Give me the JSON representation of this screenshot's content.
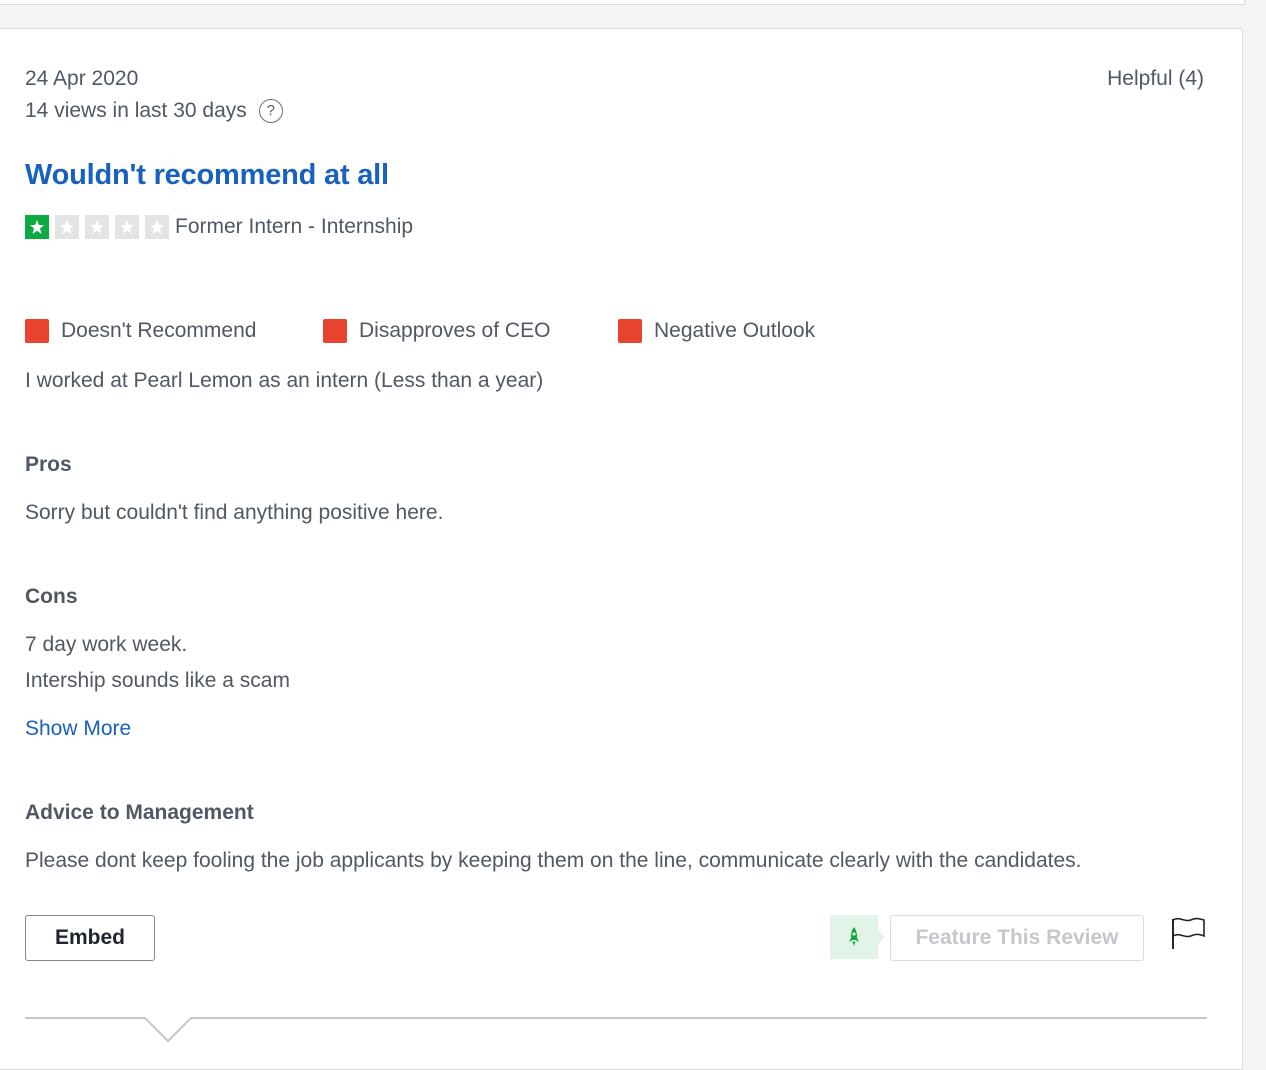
{
  "review": {
    "date": "24 Apr 2020",
    "views": "14 views in last 30 days",
    "help_glyph": "?",
    "helpful": "Helpful (4)",
    "title": "Wouldn't recommend at all",
    "rating": 1,
    "rating_max": 5,
    "job_title": "Former Intern - Internship",
    "indicators": [
      {
        "label": "Doesn't Recommend",
        "color": "#e8432f"
      },
      {
        "label": "Disapproves of CEO",
        "color": "#e8432f"
      },
      {
        "label": "Negative Outlook",
        "color": "#e8432f"
      }
    ],
    "employment": "I worked at Pearl Lemon as an intern (Less than a year)",
    "pros_heading": "Pros",
    "pros": "Sorry but couldn't find anything positive here.",
    "cons_heading": "Cons",
    "cons_lines": [
      "7 day work week.",
      "Intership sounds like a scam"
    ],
    "show_more": "Show More",
    "advice_heading": "Advice to Management",
    "advice": "Please dont keep fooling the job applicants by keeping them on the line, communicate clearly with the candidates."
  },
  "actions": {
    "embed_label": "Embed",
    "feature_label": "Feature This Review",
    "feature_icon": "rocket-icon",
    "flag_icon": "flag-icon"
  },
  "colors": {
    "title": "#1861bf",
    "star_filled": "#0caa41",
    "star_empty": "#e4e4e4",
    "indicator_negative": "#e8432f",
    "rocket_bg": "#e1f4e7"
  }
}
